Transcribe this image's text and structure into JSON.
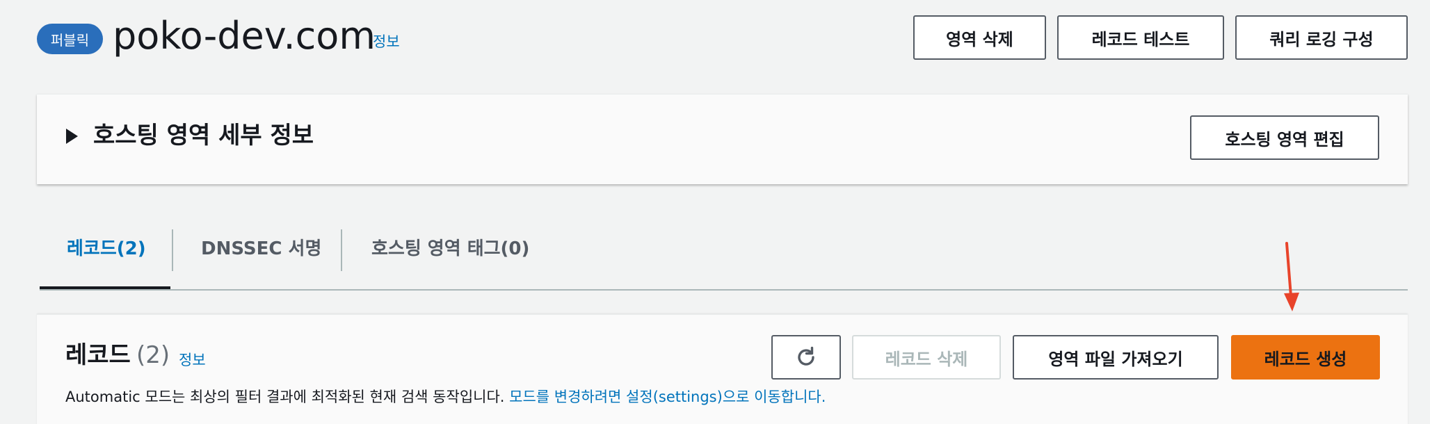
{
  "header": {
    "badge": "퍼블릭",
    "title": "poko-dev.com",
    "info_link": "정보",
    "buttons": {
      "delete_zone": "영역 삭제",
      "test_record": "레코드 테스트",
      "query_logging": "쿼리 로깅 구성"
    }
  },
  "details_panel": {
    "title": "호스팅 영역 세부 정보",
    "edit_button": "호스팅 영역 편집",
    "expanded": false
  },
  "tabs": [
    {
      "label": "레코드(2)",
      "active": true
    },
    {
      "label": "DNSSEC 서명",
      "active": false
    },
    {
      "label": "호스팅 영역 태그(0)",
      "active": false
    }
  ],
  "records": {
    "title": "레코드",
    "count": "(2)",
    "info_link": "정보",
    "buttons": {
      "refresh_icon": "refresh-icon",
      "delete": "레코드 삭제",
      "import": "영역 파일 가져오기",
      "create": "레코드 생성"
    },
    "description_text": "Automatic 모드는 최상의 필터 결과에 최적화된 현재 검색 동작입니다. ",
    "description_link": "모드를 변경하려면 설정(settings)으로 이동합니다."
  },
  "colors": {
    "accent": "#0073bb",
    "badge": "#2a6ebb",
    "primary_button": "#ec7211",
    "annotation_arrow": "#e8432a",
    "background": "#f2f3f3"
  }
}
